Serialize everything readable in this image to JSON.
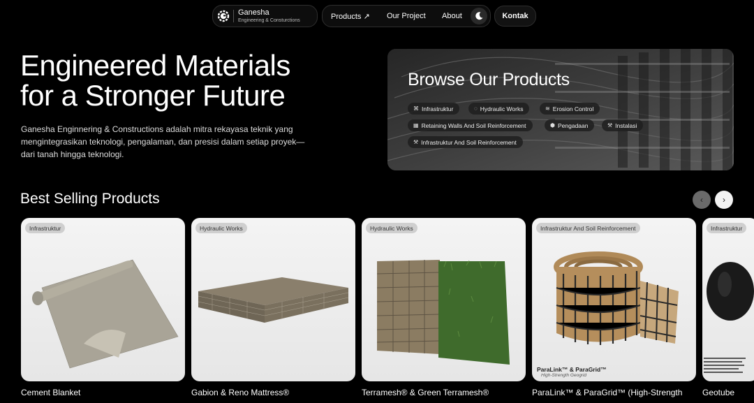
{
  "nav": {
    "brand_name": "Ganesha",
    "brand_sub": "Engineering & Consturctions",
    "links": [
      {
        "label": "Products ↗"
      },
      {
        "label": "Our Project"
      },
      {
        "label": "About"
      }
    ],
    "cta": "Kontak"
  },
  "hero": {
    "title_line1": "Engineered Materials",
    "title_line2": "for a Stronger Future",
    "description": "Ganesha Enginnering & Constructions adalah mitra rekayasa teknik yang mengintegrasikan teknologi, pengalaman, dan presisi dalam setiap proyek—dari tanah hingga teknologi."
  },
  "browse": {
    "title": "Browse Our Products",
    "categories": [
      {
        "label": "Infrastruktur",
        "icon": "network-icon"
      },
      {
        "label": "Hydraulic Works",
        "icon": "droplet-icon"
      },
      {
        "label": "Erosion Control",
        "icon": "layers-icon"
      },
      {
        "label": "Retaining Walls And Soil Reinforcement",
        "icon": "wall-icon"
      },
      {
        "label": "Pengadaan",
        "icon": "box-icon"
      },
      {
        "label": "Instalasi",
        "icon": "tools-icon"
      },
      {
        "label": "Infrastruktur And Soil Reinforcement",
        "icon": "tools-icon"
      }
    ]
  },
  "best_selling": {
    "title": "Best Selling Products",
    "products": [
      {
        "tag": "Infrastruktur",
        "name": "Cement Blanket"
      },
      {
        "tag": "Hydraulic Works",
        "name": "Gabion & Reno Mattress®"
      },
      {
        "tag": "Hydraulic Works",
        "name": "Terramesh® & Green Terramesh®"
      },
      {
        "tag": "Infrastruktur And Soil Reinforcement",
        "name": "ParaLink™ & ParaGrid™ (High-Strength"
      },
      {
        "tag": "Infrastruktur",
        "name": "Geotube"
      }
    ],
    "paralink_label": "ParaLink™ & ParaGrid™",
    "paralink_sub": "High-Strength Geogrid"
  },
  "colors": {
    "background": "#000000",
    "card_bg": "#ececec",
    "chip_bg": "#1e1e1e"
  }
}
